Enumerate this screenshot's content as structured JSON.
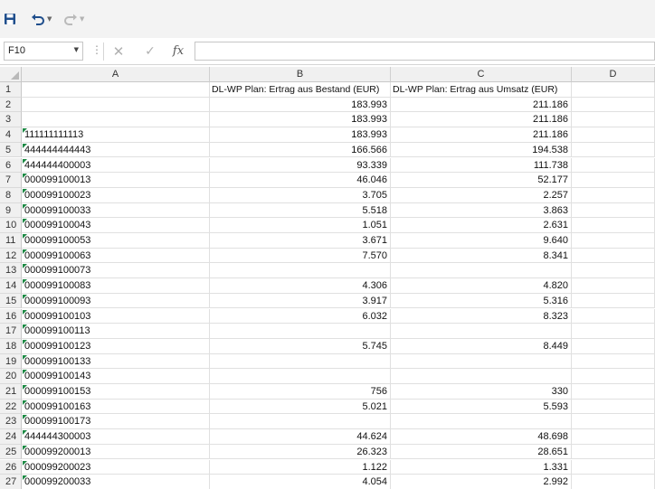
{
  "toolbar": {
    "save_icon": "save-icon",
    "undo_icon": "undo-icon",
    "redo_icon": "redo-icon"
  },
  "formula_bar": {
    "name_box": "F10",
    "cancel_glyph": "✕",
    "enter_glyph": "✓",
    "fx_label": "fx",
    "formula_value": ""
  },
  "columns": [
    "A",
    "B",
    "C",
    "D"
  ],
  "rows": [
    {
      "n": "1",
      "a": "",
      "b": "DL-WP Plan: Ertrag aus Bestand (EUR)",
      "c": "DL-WP Plan: Ertrag aus Umsatz (EUR)",
      "flag": false
    },
    {
      "n": "2",
      "a": "",
      "b": "183.993",
      "c": "211.186",
      "flag": false
    },
    {
      "n": "3",
      "a": "",
      "b": "183.993",
      "c": "211.186",
      "flag": false
    },
    {
      "n": "4",
      "a": "111111111113",
      "b": "183.993",
      "c": "211.186",
      "flag": true
    },
    {
      "n": "5",
      "a": "444444444443",
      "b": "166.566",
      "c": "194.538",
      "flag": true
    },
    {
      "n": "6",
      "a": "444444400003",
      "b": "93.339",
      "c": "111.738",
      "flag": true
    },
    {
      "n": "7",
      "a": "000099100013",
      "b": "46.046",
      "c": "52.177",
      "flag": true
    },
    {
      "n": "8",
      "a": "000099100023",
      "b": "3.705",
      "c": "2.257",
      "flag": true
    },
    {
      "n": "9",
      "a": "000099100033",
      "b": "5.518",
      "c": "3.863",
      "flag": true
    },
    {
      "n": "10",
      "a": "000099100043",
      "b": "1.051",
      "c": "2.631",
      "flag": true
    },
    {
      "n": "11",
      "a": "000099100053",
      "b": "3.671",
      "c": "9.640",
      "flag": true
    },
    {
      "n": "12",
      "a": "000099100063",
      "b": "7.570",
      "c": "8.341",
      "flag": true
    },
    {
      "n": "13",
      "a": "000099100073",
      "b": "",
      "c": "",
      "flag": true
    },
    {
      "n": "14",
      "a": "000099100083",
      "b": "4.306",
      "c": "4.820",
      "flag": true
    },
    {
      "n": "15",
      "a": "000099100093",
      "b": "3.917",
      "c": "5.316",
      "flag": true
    },
    {
      "n": "16",
      "a": "000099100103",
      "b": "6.032",
      "c": "8.323",
      "flag": true
    },
    {
      "n": "17",
      "a": "000099100113",
      "b": "",
      "c": "",
      "flag": true
    },
    {
      "n": "18",
      "a": "000099100123",
      "b": "5.745",
      "c": "8.449",
      "flag": true
    },
    {
      "n": "19",
      "a": "000099100133",
      "b": "",
      "c": "",
      "flag": true
    },
    {
      "n": "20",
      "a": "000099100143",
      "b": "",
      "c": "",
      "flag": true
    },
    {
      "n": "21",
      "a": "000099100153",
      "b": "756",
      "c": "330",
      "flag": true
    },
    {
      "n": "22",
      "a": "000099100163",
      "b": "5.021",
      "c": "5.593",
      "flag": true
    },
    {
      "n": "23",
      "a": "000099100173",
      "b": "",
      "c": "",
      "flag": true
    },
    {
      "n": "24",
      "a": "444444300003",
      "b": "44.624",
      "c": "48.698",
      "flag": true
    },
    {
      "n": "25",
      "a": "000099200013",
      "b": "26.323",
      "c": "28.651",
      "flag": true
    },
    {
      "n": "26",
      "a": "000099200023",
      "b": "1.122",
      "c": "1.331",
      "flag": true
    },
    {
      "n": "27",
      "a": "000099200033",
      "b": "4.054",
      "c": "2.992",
      "flag": true
    }
  ],
  "colors": {
    "error_flag": "#1e8a45",
    "header_bg": "#f0f0f0"
  }
}
